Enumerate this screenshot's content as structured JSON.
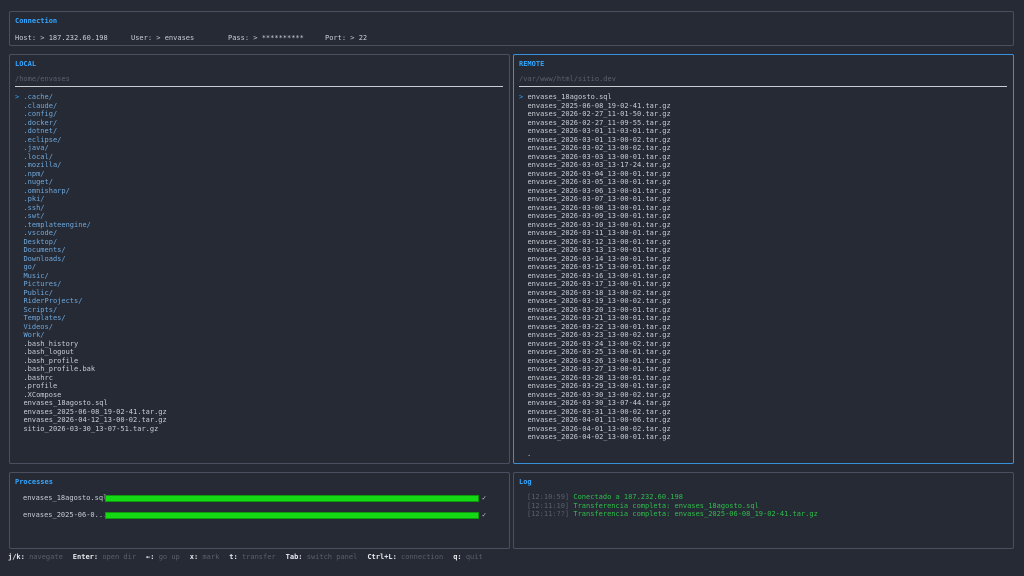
{
  "connection": {
    "title": "Connection",
    "host": "Host: > 187.232.60.198",
    "user": "User: > envases",
    "pass": "Pass: > **********",
    "port": "Port: > 22"
  },
  "local": {
    "title": "LOCAL",
    "path": "/home/envases",
    "cursor": ">",
    "items": [
      {
        "name": ".cache/",
        "type": "dir"
      },
      {
        "name": ".claude/",
        "type": "dir"
      },
      {
        "name": ".config/",
        "type": "dir"
      },
      {
        "name": ".docker/",
        "type": "dir"
      },
      {
        "name": ".dotnet/",
        "type": "dir"
      },
      {
        "name": ".eclipse/",
        "type": "dir"
      },
      {
        "name": ".java/",
        "type": "dir"
      },
      {
        "name": ".local/",
        "type": "dir"
      },
      {
        "name": ".mozilla/",
        "type": "dir"
      },
      {
        "name": ".npm/",
        "type": "dir"
      },
      {
        "name": ".nuget/",
        "type": "dir"
      },
      {
        "name": ".omnisharp/",
        "type": "dir"
      },
      {
        "name": ".pki/",
        "type": "dir"
      },
      {
        "name": ".ssh/",
        "type": "dir"
      },
      {
        "name": ".swt/",
        "type": "dir"
      },
      {
        "name": ".templateengine/",
        "type": "dir"
      },
      {
        "name": ".vscode/",
        "type": "dir"
      },
      {
        "name": "Desktop/",
        "type": "dir"
      },
      {
        "name": "Documents/",
        "type": "dir"
      },
      {
        "name": "Downloads/",
        "type": "dir"
      },
      {
        "name": "go/",
        "type": "dir"
      },
      {
        "name": "Music/",
        "type": "dir"
      },
      {
        "name": "Pictures/",
        "type": "dir"
      },
      {
        "name": "Public/",
        "type": "dir"
      },
      {
        "name": "RiderProjects/",
        "type": "dir"
      },
      {
        "name": "Scripts/",
        "type": "dir"
      },
      {
        "name": "Templates/",
        "type": "dir"
      },
      {
        "name": "Videos/",
        "type": "dir"
      },
      {
        "name": "Work/",
        "type": "dir"
      },
      {
        "name": ".bash_history",
        "type": "file"
      },
      {
        "name": ".bash_logout",
        "type": "file"
      },
      {
        "name": ".bash_profile",
        "type": "file"
      },
      {
        "name": ".bash_profile.bak",
        "type": "file"
      },
      {
        "name": ".bashrc",
        "type": "file"
      },
      {
        "name": ".profile",
        "type": "file"
      },
      {
        "name": ".XCompose",
        "type": "file"
      },
      {
        "name": "envases_18agosto.sql",
        "type": "file"
      },
      {
        "name": "envases_2025-06-08_19-02-41.tar.gz",
        "type": "file"
      },
      {
        "name": "envases_2026-04-12_13-00-02.tar.gz",
        "type": "file"
      },
      {
        "name": "sitio_2026-03-30_13-07-51.tar.gz",
        "type": "file"
      }
    ]
  },
  "remote": {
    "title": "REMOTE",
    "path": "/var/www/html/sitio.dev",
    "cursor": ">",
    "items": [
      "envases_18agosto.sql",
      "envases_2025-06-08_19-02-41.tar.gz",
      "envases_2026-02-27_11-01-50.tar.gz",
      "envases_2026-02-27_11-09-55.tar.gz",
      "envases_2026-03-01_11-03-01.tar.gz",
      "envases_2026-03-01_13-00-02.tar.gz",
      "envases_2026-03-02_13-00-02.tar.gz",
      "envases_2026-03-03_13-00-01.tar.gz",
      "envases_2026-03-03_13-17-24.tar.gz",
      "envases_2026-03-04_13-00-01.tar.gz",
      "envases_2026-03-05_13-00-01.tar.gz",
      "envases_2026-03-06_13-00-01.tar.gz",
      "envases_2026-03-07_13-00-01.tar.gz",
      "envases_2026-03-08_13-00-01.tar.gz",
      "envases_2026-03-09_13-00-01.tar.gz",
      "envases_2026-03-10_13-00-01.tar.gz",
      "envases_2026-03-11_13-00-01.tar.gz",
      "envases_2026-03-12_13-00-01.tar.gz",
      "envases_2026-03-13_13-00-01.tar.gz",
      "envases_2026-03-14_13-00-01.tar.gz",
      "envases_2026-03-15_13-00-01.tar.gz",
      "envases_2026-03-16_13-00-01.tar.gz",
      "envases_2026-03-17_13-00-01.tar.gz",
      "envases_2026-03-18_13-00-02.tar.gz",
      "envases_2026-03-19_13-00-02.tar.gz",
      "envases_2026-03-20_13-00-01.tar.gz",
      "envases_2026-03-21_13-00-01.tar.gz",
      "envases_2026-03-22_13-00-01.tar.gz",
      "envases_2026-03-23_13-00-02.tar.gz",
      "envases_2026-03-24_13-00-02.tar.gz",
      "envases_2026-03-25_13-00-01.tar.gz",
      "envases_2026-03-26_13-00-01.tar.gz",
      "envases_2026-03-27_13-00-01.tar.gz",
      "envases_2026-03-28_13-00-01.tar.gz",
      "envases_2026-03-29_13-00-01.tar.gz",
      "envases_2026-03-30_13-00-02.tar.gz",
      "envases_2026-03-30_13-07-44.tar.gz",
      "envases_2026-03-31_13-00-02.tar.gz",
      "envases_2026-04-01_11-00-06.tar.gz",
      "envases_2026-04-01_13-00-02.tar.gz",
      "envases_2026-04-02_13-00-01.tar.gz"
    ],
    "more": "."
  },
  "processes": {
    "title": "Processes",
    "items": [
      {
        "name": "envases_18agosto.sql",
        "progress": 1.0,
        "status": "✓"
      },
      {
        "name": "envases_2025-06-0...",
        "progress": 1.0,
        "status": "✓"
      }
    ]
  },
  "log": {
    "title": "Log",
    "entries": [
      {
        "time": "[12:10:59]",
        "message": "Conectado a 187.232.60.198"
      },
      {
        "time": "[12:11:10]",
        "message": "Transferencia completa: envases_18agosto.sql"
      },
      {
        "time": "[12:11:??]",
        "message": "Transferencia completa: envases_2025-06-08_19-02-41.tar.gz"
      }
    ]
  },
  "footer": [
    {
      "key": "j/k:",
      "desc": "navegate"
    },
    {
      "key": "Enter:",
      "desc": "open dir"
    },
    {
      "key": "←:",
      "desc": "go up"
    },
    {
      "key": "x:",
      "desc": "mark"
    },
    {
      "key": "t:",
      "desc": "transfer"
    },
    {
      "key": "Tab:",
      "desc": "switch panel"
    },
    {
      "key": "Ctrl+L:",
      "desc": "connection"
    },
    {
      "key": "q:",
      "desc": "quit"
    }
  ],
  "colors": {
    "accent": "#33a6ff",
    "directory": "#6fa8dc",
    "progress": "#16d916",
    "log_message": "#2fbf4a"
  }
}
